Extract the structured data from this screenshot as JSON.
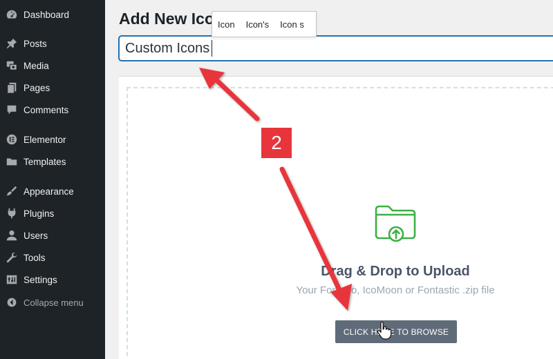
{
  "sidebar": {
    "items": [
      {
        "label": "Dashboard",
        "icon": "dashboard-icon"
      },
      {
        "label": "Posts",
        "icon": "pin-icon"
      },
      {
        "label": "Media",
        "icon": "media-icon"
      },
      {
        "label": "Pages",
        "icon": "pages-icon"
      },
      {
        "label": "Comments",
        "icon": "comment-icon"
      },
      {
        "label": "Elementor",
        "icon": "elementor-icon"
      },
      {
        "label": "Templates",
        "icon": "folder-icon"
      },
      {
        "label": "Appearance",
        "icon": "brush-icon"
      },
      {
        "label": "Plugins",
        "icon": "plug-icon"
      },
      {
        "label": "Users",
        "icon": "user-icon"
      },
      {
        "label": "Tools",
        "icon": "wrench-icon"
      },
      {
        "label": "Settings",
        "icon": "settings-icon"
      }
    ],
    "collapse_label": "Collapse menu"
  },
  "main": {
    "title": "Add New Icon",
    "name_input_value": "Custom Icons",
    "suggestions": [
      "Icon",
      "Icon's",
      "Icon s"
    ],
    "upload": {
      "title": "Drag & Drop to Upload",
      "subtitle": "Your Fontello, IcoMoon or Fontastic .zip file",
      "browse_label": "CLICK HERE TO BROWSE"
    }
  },
  "annotation": {
    "step_number": "2",
    "color": "#e8353b"
  },
  "colors": {
    "sidebar_bg": "#1d2327",
    "accent": "#2271b1",
    "upload_icon": "#3cb043",
    "button_bg": "#5f6b78"
  }
}
